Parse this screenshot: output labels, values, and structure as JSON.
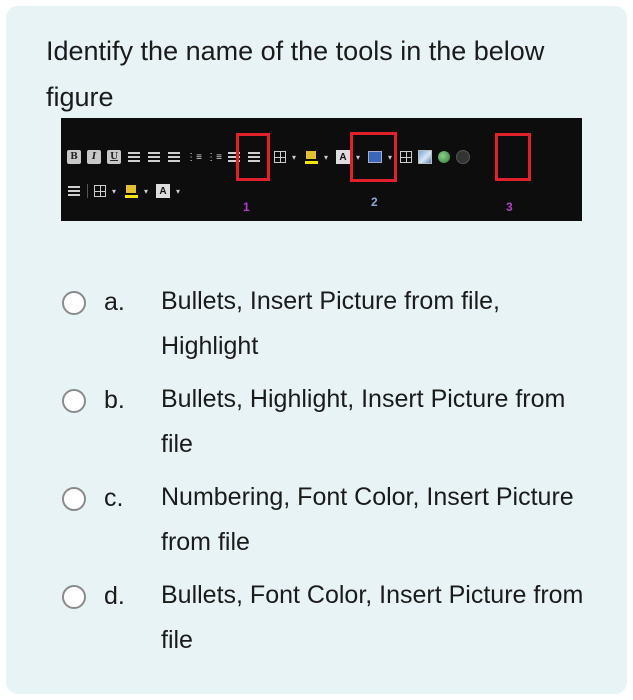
{
  "question": {
    "text": "Identify the name of the tools in the below figure"
  },
  "figure": {
    "description_labels": [
      "1",
      "2",
      "3"
    ],
    "toolbar_row1": [
      "B",
      "I",
      "U",
      "align-left",
      "align-center",
      "align-right",
      "numbering",
      "bullets",
      "decrease-indent",
      "increase-indent",
      "table",
      "highlight",
      "font-color",
      "table-color",
      "table-insert",
      "insert-picture",
      "insert-link",
      "circle"
    ],
    "toolbar_row2": [
      "increase-indent",
      "table",
      "highlight",
      "font-color"
    ],
    "accent": "#e0202a",
    "label_colors": [
      "#b03cc8",
      "#8fa7d6",
      "#b03cc8"
    ],
    "bold_label": "B",
    "italic_label": "I",
    "underline_label": "U",
    "font_color_label": "A"
  },
  "options": [
    {
      "letter": "a.",
      "text": "Bullets, Insert Picture from file, Highlight"
    },
    {
      "letter": "b.",
      "text": "Bullets, Highlight, Insert Picture from file"
    },
    {
      "letter": "c.",
      "text": "Numbering, Font Color, Insert Picture from file"
    },
    {
      "letter": "d.",
      "text": "Bullets, Font Color, Insert Picture from file"
    }
  ]
}
